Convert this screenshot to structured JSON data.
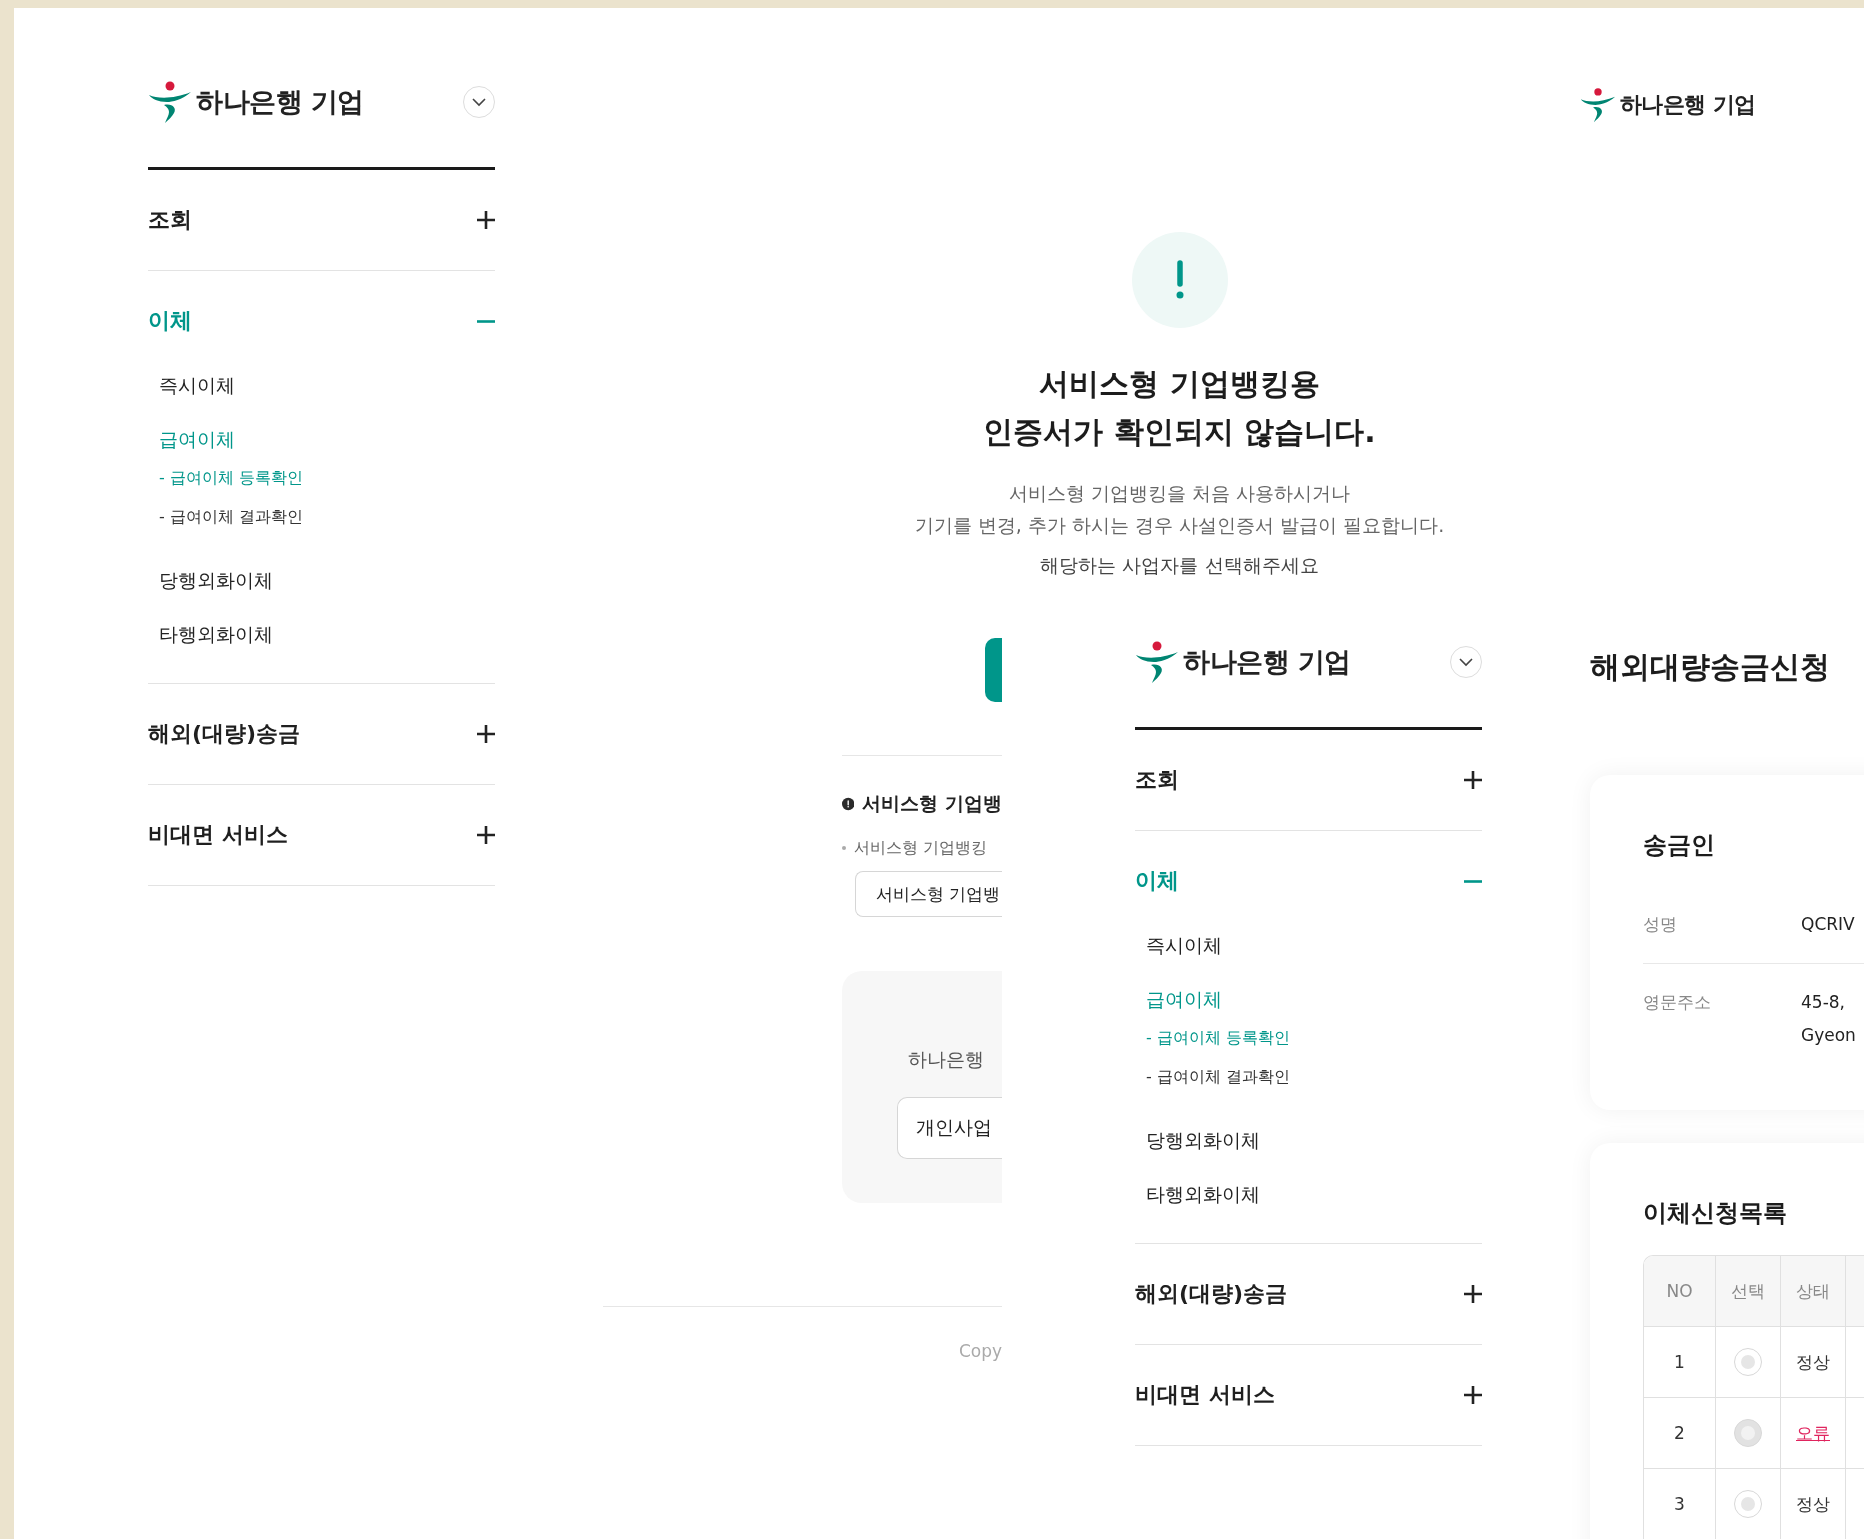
{
  "back_screen": {
    "sidebar": {
      "logo_text": "하나은행 기업",
      "sections": [
        {
          "label": "조회",
          "expanded": false
        },
        {
          "label": "이체",
          "expanded": true,
          "children": [
            {
              "label": "즉시이체",
              "selected": false
            },
            {
              "label": "급여이체",
              "selected": true,
              "children": [
                {
                  "label": "- 급여이체 등록확인",
                  "selected": true
                },
                {
                  "label": "- 급여이체 결과확인",
                  "selected": false
                }
              ]
            },
            {
              "label": "당행외화이체",
              "selected": false
            },
            {
              "label": "타행외화이체",
              "selected": false
            }
          ]
        },
        {
          "label": "해외(대량)송금",
          "expanded": false
        },
        {
          "label": "비대면 서비스",
          "expanded": false
        }
      ]
    },
    "header_logo_text": "하나은행 기업",
    "alert": {
      "title_lines": [
        "서비스형 기업뱅킹용",
        "인증서가 확인되지 않습니다."
      ],
      "description_lines": [
        "서비스형 기업뱅킹을 처음 사용하시거나",
        "기기를 변경, 추가 하시는 경우 사설인증서 발급이 필요합니다."
      ],
      "prompt": "해당하는 사업자를 선택해주세요"
    },
    "notice": {
      "heading": "서비스형 기업뱅",
      "bullet": "서비스형 기업뱅킹",
      "button": "서비스형 기업뱅"
    },
    "choice_card": {
      "text": "하나은행",
      "button": "개인사업"
    },
    "footer": "Copy"
  },
  "front_screen": {
    "sidebar": {
      "logo_text": "하나은행 기업",
      "sections": [
        {
          "label": "조회",
          "expanded": false
        },
        {
          "label": "이체",
          "expanded": true,
          "children": [
            {
              "label": "즉시이체",
              "selected": false
            },
            {
              "label": "급여이체",
              "selected": true,
              "children": [
                {
                  "label": "- 급여이체 등록확인",
                  "selected": true
                },
                {
                  "label": "- 급여이체 결과확인",
                  "selected": false
                }
              ]
            },
            {
              "label": "당행외화이체",
              "selected": false
            },
            {
              "label": "타행외화이체",
              "selected": false
            }
          ]
        },
        {
          "label": "해외(대량)송금",
          "expanded": false
        },
        {
          "label": "비대면 서비스",
          "expanded": false
        }
      ]
    },
    "page_title": "해외대량송금신청",
    "sender_card": {
      "title": "송금인",
      "rows": [
        {
          "label": "성명",
          "value_lines": [
            "QCRIV"
          ]
        },
        {
          "label": "영문주소",
          "value_lines": [
            "45-8,",
            "Gyeon"
          ]
        }
      ]
    },
    "transfer_list": {
      "title": "이체신청목록",
      "columns": [
        "NO",
        "선택",
        "상태"
      ],
      "rows": [
        {
          "no": "1",
          "radio_disabled": false,
          "status": "정상",
          "error": false
        },
        {
          "no": "2",
          "radio_disabled": true,
          "status": "오류",
          "error": true
        },
        {
          "no": "3",
          "radio_disabled": false,
          "status": "정상",
          "error": false
        }
      ]
    }
  }
}
